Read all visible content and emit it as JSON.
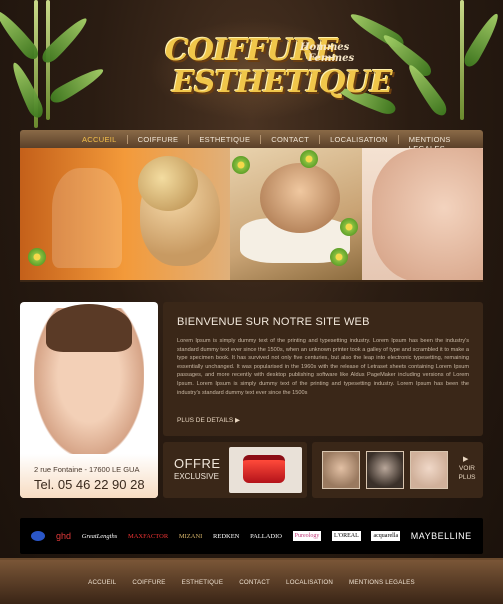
{
  "header": {
    "logo_line1": "COIFFURE",
    "logo_line2": "ESTHETIQUE",
    "logo_sub1": "Hommes",
    "logo_sub2": "Femmes"
  },
  "nav": {
    "items": [
      "ACCUEIL",
      "COIFFURE",
      "ESTHETIQUE",
      "CONTACT",
      "LOCALISATION",
      "MENTIONS LEGALES"
    ],
    "active": "ACCUEIL",
    "active_color": "#f5c04a"
  },
  "contact_card": {
    "address": "2 rue Fontaine - 17600 LE GUA",
    "phone": "Tel. 05 46 22 90 28"
  },
  "welcome": {
    "title": "BIENVENUE SUR NOTRE SITE WEB",
    "text": "Lorem Ipsum is simply dummy text of the printing and typesetting industry. Lorem Ipsum has been the industry's standard dummy text ever since the 1500s, when an unknown printer took a galley of type and scrambled it to make a type specimen book. It has survived not only five centuries, but also the leap into electronic typesetting, remaining essentially unchanged. It was popularised in the 1960s with the release of Letraset sheets containing Lorem Ipsum passages, and more recently with desktop publishing software like Aldus PageMaker including versions of Lorem Ipsum. Lorem Ipsum is simply dummy text of the printing and typesetting industry. Lorem Ipsum has been the industry's standard dummy text ever since the 1500s",
    "more_label": "PLUS DE DETAILS"
  },
  "offer": {
    "line1": "OFFRE",
    "line2": "EXCLUSIVE"
  },
  "gallery": {
    "more_line1": "VOIR",
    "more_line2": "PLUS"
  },
  "brands": [
    "ghd",
    "GreatLengths",
    "MAXFACTOR",
    "MIZANI",
    "REDKEN",
    "PALLADIO",
    "Pureology",
    "L'OREAL",
    "acquarella",
    "MAYBELLINE"
  ],
  "footer": {
    "items": [
      "ACCUEIL",
      "COIFFURE",
      "ESTHETIQUE",
      "CONTACT",
      "LOCALISATION",
      "MENTIONS LEGALES"
    ]
  },
  "colors": {
    "background": "#2a1c12",
    "panel": "#3a2718",
    "logo_gold": "#f0c64a",
    "leaf_green": "#6faa32"
  }
}
